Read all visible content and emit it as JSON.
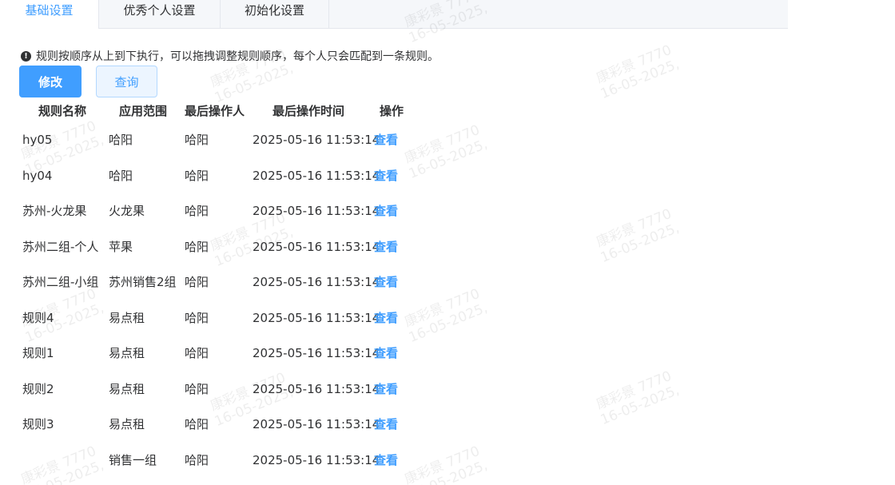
{
  "tabs": [
    {
      "label": "基础设置"
    },
    {
      "label": "优秀个人设置"
    },
    {
      "label": "初始化设置"
    }
  ],
  "notice": {
    "icon": "exclamation-circle-icon",
    "text": "规则按顺序从上到下执行，可以拖拽调整规则顺序，每个人只会匹配到一条规则。"
  },
  "buttons": {
    "edit": "修改",
    "query": "查询"
  },
  "table": {
    "headers": {
      "name": "规则名称",
      "scope": "应用范围",
      "operator": "最后操作人",
      "time": "最后操作时间",
      "action": "操作"
    },
    "rows": [
      {
        "name": "hy05",
        "scope": "哈阳",
        "operator": "哈阳",
        "time": "2025-05-16 11:53:14",
        "action": "查看"
      },
      {
        "name": "hy04",
        "scope": "哈阳",
        "operator": "哈阳",
        "time": "2025-05-16 11:53:14",
        "action": "查看"
      },
      {
        "name": "苏州-火龙果",
        "scope": "火龙果",
        "operator": "哈阳",
        "time": "2025-05-16 11:53:14",
        "action": "查看"
      },
      {
        "name": "苏州二组-个人",
        "scope": "苹果",
        "operator": "哈阳",
        "time": "2025-05-16 11:53:14",
        "action": "查看"
      },
      {
        "name": "苏州二组-小组",
        "scope": "苏州销售2组",
        "operator": "哈阳",
        "time": "2025-05-16 11:53:14",
        "action": "查看"
      },
      {
        "name": "规则4",
        "scope": "易点租",
        "operator": "哈阳",
        "time": "2025-05-16 11:53:14",
        "action": "查看"
      },
      {
        "name": "规则1",
        "scope": "易点租",
        "operator": "哈阳",
        "time": "2025-05-16 11:53:14",
        "action": "查看"
      },
      {
        "name": "规则2",
        "scope": "易点租",
        "operator": "哈阳",
        "time": "2025-05-16 11:53:14",
        "action": "查看"
      },
      {
        "name": "规则3",
        "scope": "易点租",
        "operator": "哈阳",
        "time": "2025-05-16 11:53:14",
        "action": "查看"
      },
      {
        "name": "",
        "scope": "销售一组",
        "operator": "哈阳",
        "time": "2025-05-16 11:53:14",
        "action": "查看"
      }
    ]
  },
  "watermark": {
    "line1": "康彩景 7770",
    "line2": "16-05-2025,"
  },
  "colors": {
    "primary": "#409eff",
    "primary_light_bg": "#ecf5ff",
    "text": "#303133"
  }
}
